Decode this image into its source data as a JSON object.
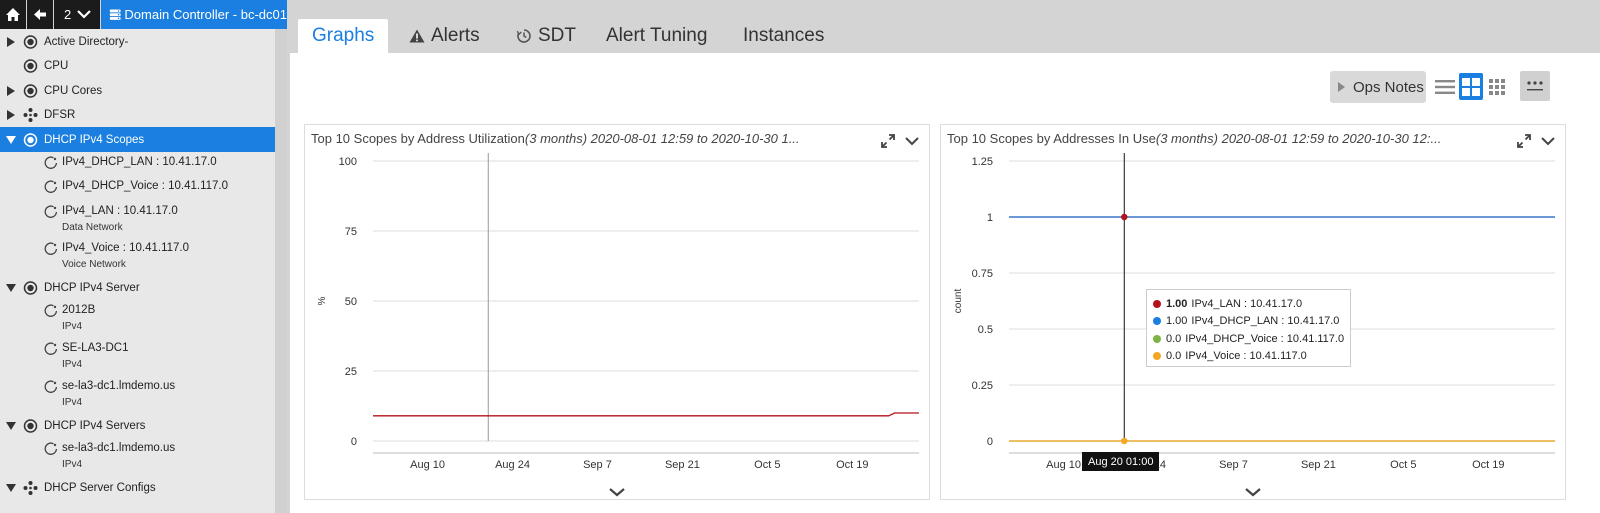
{
  "nav": {
    "history_count": "2",
    "breadcrumb": "Domain Controller - bc-dc01"
  },
  "tree": {
    "items": [
      {
        "label": "Active Directory-",
        "icon": "instance-target-icon",
        "expanded": false
      },
      {
        "label": "CPU",
        "icon": "instance-target-icon"
      },
      {
        "label": "CPU Cores",
        "icon": "instance-target-icon",
        "expanded": false
      },
      {
        "label": "DFSR",
        "icon": "cluster-icon",
        "expanded": false
      },
      {
        "label": "DHCP IPv4 Scopes",
        "icon": "instance-target-icon",
        "expanded": true,
        "selected": true
      },
      {
        "label": "IPv4_DHCP_LAN : 10.41.17.0",
        "icon": "instance-ring-icon",
        "child": true
      },
      {
        "label": "IPv4_DHCP_Voice : 10.41.117.0",
        "icon": "instance-ring-icon",
        "child": true
      },
      {
        "label": "IPv4_LAN : 10.41.17.0",
        "sub": "Data Network",
        "icon": "instance-ring-icon",
        "child": true
      },
      {
        "label": "IPv4_Voice : 10.41.117.0",
        "sub": "Voice Network",
        "icon": "instance-ring-icon",
        "child": true
      },
      {
        "label": "DHCP IPv4 Server",
        "icon": "instance-target-icon",
        "expanded": true
      },
      {
        "label": "2012B",
        "sub": "IPv4",
        "icon": "instance-ring-icon",
        "child": true
      },
      {
        "label": "SE-LA3-DC1",
        "sub": "IPv4",
        "icon": "instance-ring-icon",
        "child": true
      },
      {
        "label": "se-la3-dc1.lmdemo.us",
        "sub": "IPv4",
        "icon": "instance-ring-icon",
        "child": true
      },
      {
        "label": "DHCP IPv4 Servers",
        "icon": "instance-target-icon",
        "expanded": true
      },
      {
        "label": "se-la3-dc1.lmdemo.us",
        "sub": "IPv4",
        "icon": "instance-ring-icon",
        "child": true
      },
      {
        "label": "DHCP Server Configs",
        "icon": "cluster-icon",
        "expanded": true
      }
    ]
  },
  "tabs": [
    {
      "label": "Graphs",
      "active": true
    },
    {
      "label": "Alerts",
      "icon": "warning-icon"
    },
    {
      "label": "SDT",
      "icon": "sdt-clock-icon"
    },
    {
      "label": "Alert Tuning"
    },
    {
      "label": "Instances"
    }
  ],
  "toolbar": {
    "ops_notes_label": "Ops Notes",
    "active_view": "grid"
  },
  "colors": {
    "accent": "#1a7fe0",
    "series_red": "#b5121b",
    "series_blue": "#1a7fe0",
    "series_green": "#7cb342",
    "series_orange": "#f5a623"
  },
  "chart_data": [
    {
      "type": "line",
      "title": "Top 10 Scopes by Address Utilization",
      "title_suffix": "(3 months) 2020-08-01 12:59 to 2020-10-30 1...",
      "ylabel": "%",
      "ylim": [
        0,
        100
      ],
      "yticks": [
        "100",
        "75",
        "50",
        "25",
        "0"
      ],
      "xticks": [
        "Aug 10",
        "Aug 24",
        "Sep 7",
        "Sep 21",
        "Oct 5",
        "Oct 19"
      ],
      "xrange": [
        "2020-08-01",
        "2020-10-30"
      ],
      "cursor_date": "2020-08-20",
      "grid": true,
      "series": [
        {
          "color": "#b5121b",
          "x": [
            "2020-08-01",
            "2020-10-25",
            "2020-10-26",
            "2020-10-30"
          ],
          "values": [
            9,
            9,
            10,
            10
          ]
        }
      ]
    },
    {
      "type": "line",
      "title": "Top 10 Scopes by Addresses In Use",
      "title_suffix": "(3 months) 2020-08-01 12:59 to 2020-10-30 12:...",
      "ylabel": "count",
      "ylim": [
        0,
        1.25
      ],
      "yticks": [
        "1.25",
        "1",
        "0.75",
        "0.5",
        "0.25",
        "0"
      ],
      "xticks": [
        "Aug 10",
        "Aug 24",
        "Sep 7",
        "Sep 21",
        "Oct 5",
        "Oct 19"
      ],
      "xrange": [
        "2020-08-01",
        "2020-10-30"
      ],
      "cursor_date": "2020-08-20",
      "grid": true,
      "legend_position": "center",
      "tooltip": "Aug 20 01:00",
      "series": [
        {
          "name": "IPv4_LAN : 10.41.17.0",
          "value_label": "1.00",
          "color": "#b5121b",
          "x": [
            "2020-08-01",
            "2020-10-30"
          ],
          "values": [
            1,
            1
          ]
        },
        {
          "name": "IPv4_DHCP_LAN : 10.41.17.0",
          "value_label": "1.00",
          "color": "#1a7fe0",
          "x": [
            "2020-08-01",
            "2020-10-30"
          ],
          "values": [
            1,
            1
          ]
        },
        {
          "name": "IPv4_DHCP_Voice : 10.41.117.0",
          "value_label": "0.0",
          "color": "#7cb342",
          "x": [
            "2020-08-01",
            "2020-10-30"
          ],
          "values": [
            0,
            0
          ]
        },
        {
          "name": "IPv4_Voice : 10.41.117.0",
          "value_label": "0.0",
          "color": "#f5a623",
          "x": [
            "2020-08-01",
            "2020-10-30"
          ],
          "values": [
            0,
            0
          ]
        }
      ]
    }
  ]
}
